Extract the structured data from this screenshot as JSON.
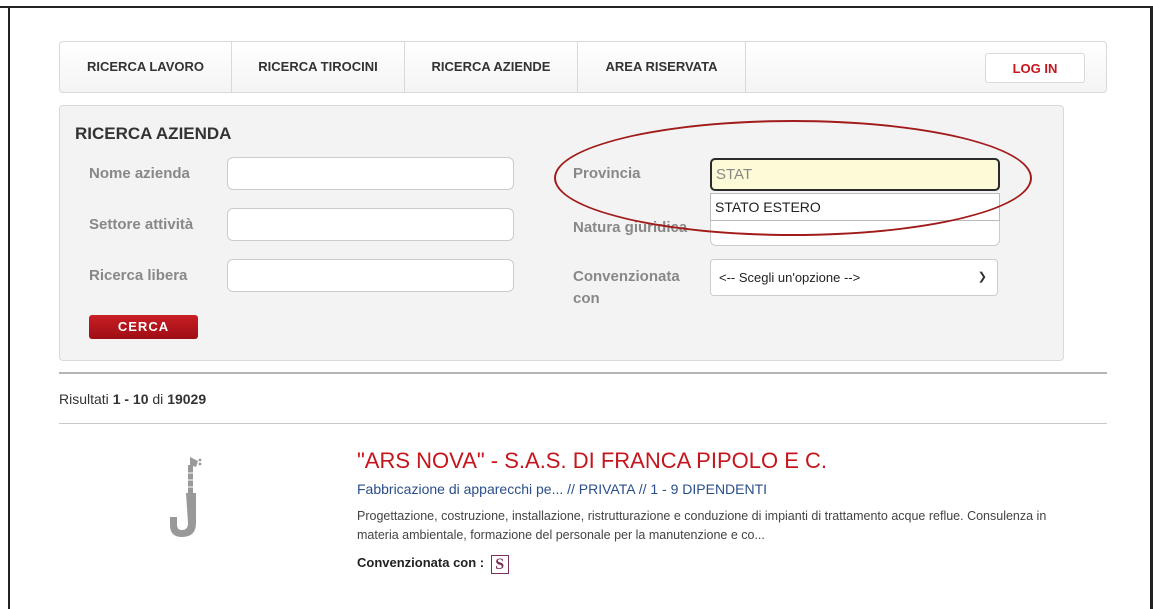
{
  "nav": {
    "items": [
      "RICERCA LAVORO",
      "RICERCA TIROCINI",
      "RICERCA AZIENDE",
      "AREA RISERVATA"
    ],
    "login_label": "LOG IN"
  },
  "search": {
    "title": "RICERCA AZIENDA",
    "labels": {
      "nome": "Nome azienda",
      "settore": "Settore attività",
      "ricerca_libera": "Ricerca libera",
      "provincia": "Provincia",
      "natura": "Natura giuridica",
      "convenzionata_line1": "Convenzionata",
      "convenzionata_line2": "con"
    },
    "provincia_value": "STAT",
    "autocomplete_option": "STATO ESTERO",
    "convenzionata_selected": "<-- Scegli un'opzione -->",
    "button_label": "CERCA"
  },
  "results": {
    "prefix": "Risultati",
    "range": "1 - 10",
    "of": "di",
    "total": "19029"
  },
  "result_item": {
    "title": "\"ARS NOVA\" - S.A.S. DI FRANCA PIPOLO E C.",
    "subtitle": "Fabbricazione di apparecchi pe... // PRIVATA // 1 - 9 DIPENDENTI",
    "description": "Progettazione, costruzione, installazione, ristrutturazione e conduzione di impianti di trattamento acque reflue. Consulenza in materia ambientale, formazione del personale per la manutenzione e co...",
    "conv_label": "Convenzionata con :",
    "conv_badge": "S",
    "icon": "guitar-icon"
  },
  "colors": {
    "accent_red": "#c4161c",
    "link_blue": "#2a4e8a",
    "highlight_ellipse": "#a11b1b"
  }
}
